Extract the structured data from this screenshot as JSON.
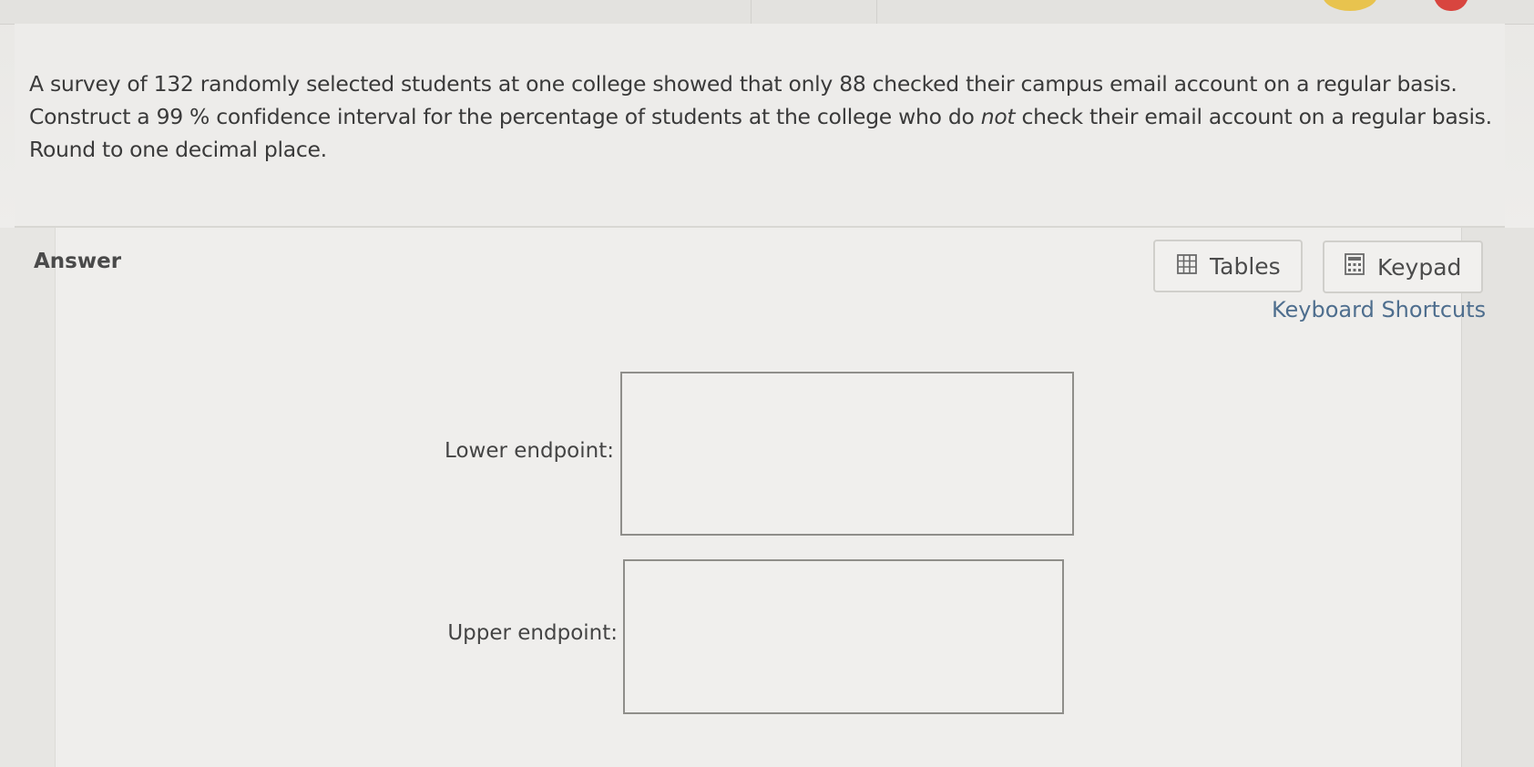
{
  "question": {
    "part1": "A survey of 132 randomly selected students at one college showed that only 88 checked their campus email account on a regular basis. Construct a 99 % confidence interval for the percentage of students at the college who do ",
    "emphasis": "not",
    "part2": " check their email account on a regular basis. Round to one decimal place."
  },
  "answer": {
    "label": "Answer"
  },
  "tools": {
    "tables_label": "Tables",
    "keypad_label": "Keypad",
    "shortcuts_label": "Keyboard Shortcuts"
  },
  "fields": {
    "lower_label": "Lower endpoint:",
    "lower_value": "",
    "upper_label": "Upper endpoint:",
    "upper_value": ""
  },
  "icons": {
    "tables": "table-grid-icon",
    "keypad": "calculator-icon"
  }
}
